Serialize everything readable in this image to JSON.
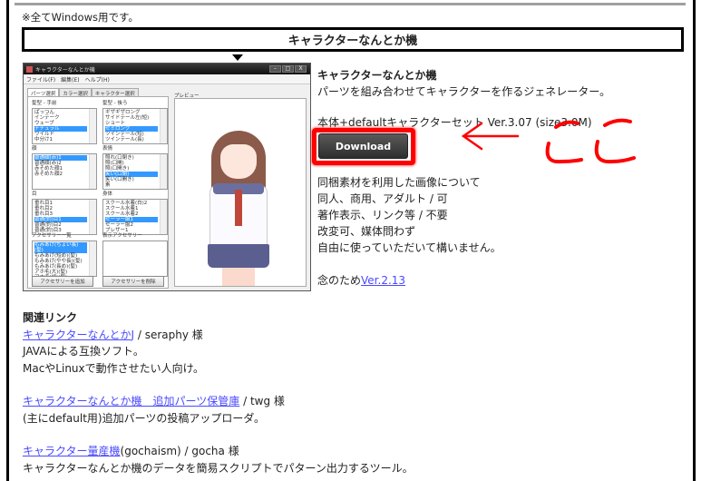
{
  "note": "※全てWindows用です。",
  "section_title": "キャラクターなんとか機",
  "app_screenshot": {
    "window_title": "キャラクターなんとか機",
    "window_buttons": [
      "–",
      "□",
      "X"
    ],
    "menu": [
      "ファイル(F)",
      "編集(E)",
      "ヘルプ(H)"
    ],
    "tabs": [
      "パーツ選択",
      "カラー選択",
      "キャラクター選択"
    ],
    "groups": [
      {
        "label": "髪型 - 手前",
        "items": [
          "ぱっつん",
          "インテーク",
          "ウェーブ",
          "ナチュラル",
          "ワイルド",
          "中分け1"
        ],
        "selected": 3
      },
      {
        "label": "髪型 - 後ろ",
        "items": [
          "ギザギザロング",
          "サイドテール左(短)",
          "ショート",
          "セミロング",
          "ツインテール(短)",
          "ツインテール(長)"
        ],
        "selected": 3
      },
      {
        "label": "顔",
        "items": [
          "普通顔(赤)1",
          "普通顔(赤)2",
          "赤そめた顔1",
          "赤そめた顔2"
        ],
        "selected": 0
      },
      {
        "label": "表情",
        "items": [
          "照れ(口閉き)",
          "照(口開)",
          "照(口開き)",
          "笑い(口閉)",
          "笑い(口開き)",
          "素"
        ],
        "selected": 3
      },
      {
        "label": "目",
        "items": [
          "垂れ目1",
          "垂れ目2",
          "垂れ目3",
          "普通(釣)目1",
          "普通(釣)目2",
          "普通(釣)目3"
        ],
        "selected": 3
      },
      {
        "label": "身体",
        "items": [
          "スクール水着(白)2",
          "スクール水着1",
          "スクール水着2",
          "セーラー服1",
          "セーラー服2",
          "ブレザー1"
        ],
        "selected": 3
      },
      {
        "label": "アクセサリー一覧",
        "items": [
          "もみあげ(ちょい長)(髪)",
          "もみあげ(短め)(髪)",
          "もみあげ(やや長)(髪)",
          "もみあげ(長め)(髪)",
          "アホ毛(大)(髪)",
          "アホ毛(細)(髪)"
        ],
        "selected": 0
      },
      {
        "label": "表示アクセサリー",
        "items": [],
        "selected": -1
      }
    ],
    "add_button": "アクセサリーを追加",
    "remove_button": "アクセサリーを削除",
    "preview_label": "プレビュー"
  },
  "info": {
    "title": "キャラクターなんとか機",
    "description": "パーツを組み合わせてキャラクターを作るジェネレーター。",
    "version_line": "本体+defaultキャラクターセット Ver.3.07 (size3.0M)",
    "download_label": "Download",
    "annotation_text": "ここ",
    "annotation_color": "#ff0000"
  },
  "license": [
    "同梱素材を利用した画像について",
    "同人、商用、アダルト / 可",
    "著作表示、リンク等 / 不要",
    "改変可、媒体問わず",
    "自由に使っていただいて構いません。"
  ],
  "old_version": {
    "prefix": "念のため",
    "link": "Ver.2.13"
  },
  "related": {
    "heading": "関連リンク",
    "items": [
      {
        "link": "キャラクターなんとかJ",
        "suffix": " / seraphy 様",
        "desc": [
          "JAVAによる互換ソフト。",
          "MacやLinuxで動作させたい人向け。"
        ]
      },
      {
        "link": "キャラクターなんとか機　追加パーツ保管庫",
        "suffix": " / twg 様",
        "desc": [
          "(主にdefault用)追加パーツの投稿アップローダ。"
        ]
      },
      {
        "link": "キャラクター量産機",
        "suffix": "(gochaism) / gocha 様",
        "desc": [
          "キャラクターなんとか機のデータを簡易スクリプトでパターン出力するツール。"
        ]
      }
    ]
  },
  "colors": {
    "link": "#4a4aff",
    "highlight": "#ff0000"
  }
}
